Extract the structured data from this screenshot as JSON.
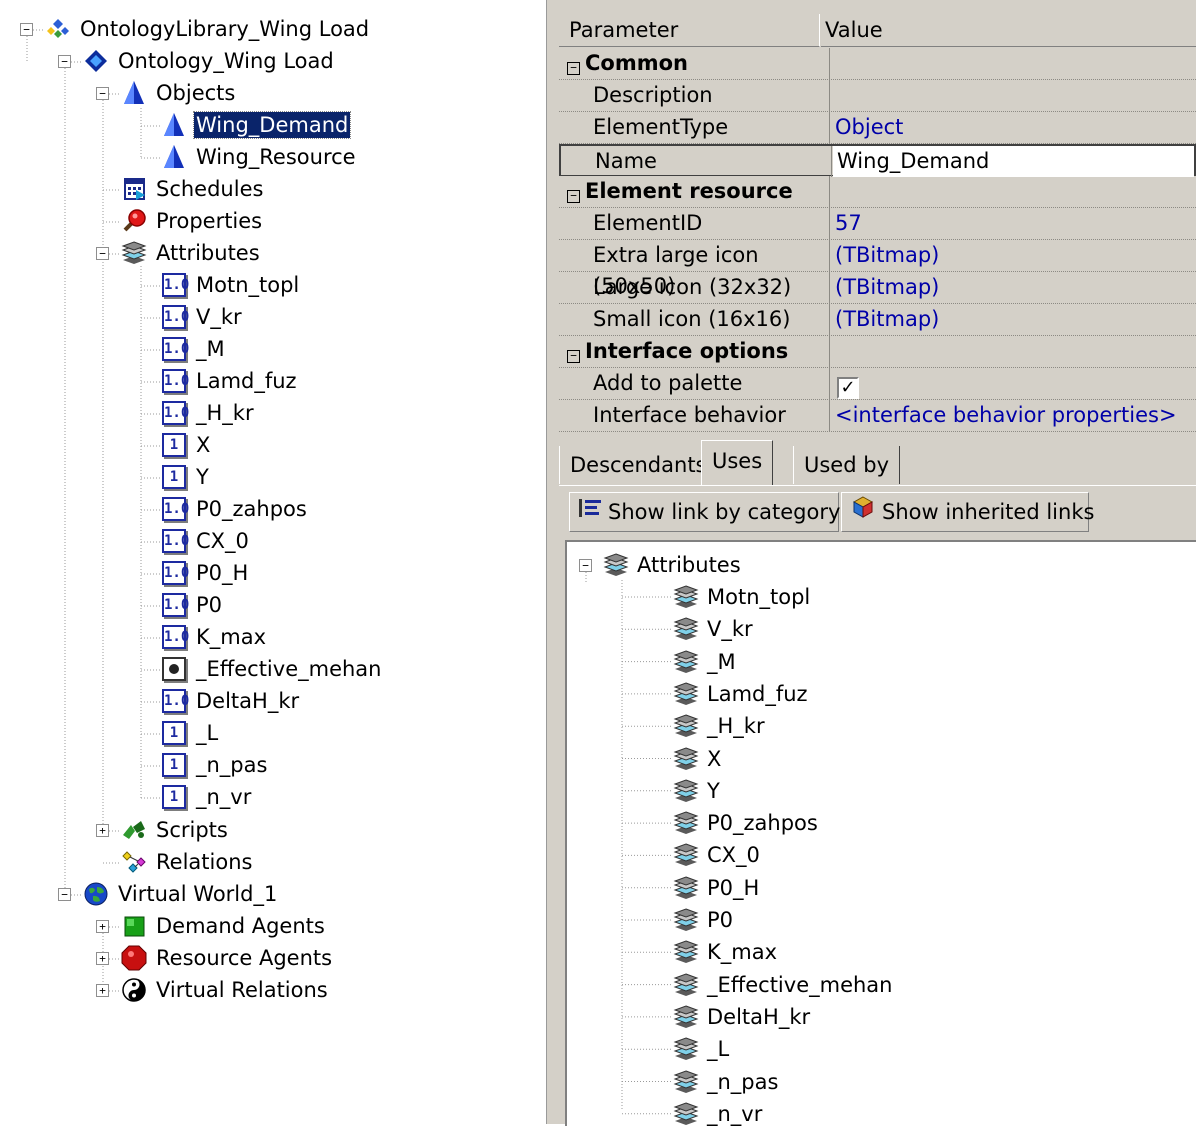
{
  "left_tree": {
    "root": {
      "label": "OntologyLibrary_Wing Load",
      "icon": "ontology-library-icon"
    },
    "ontology": {
      "label": "Ontology_Wing Load",
      "icon": "ontology-diamond-icon"
    },
    "objects": {
      "label": "Objects",
      "icon": "object-cone-icon"
    },
    "wing_demand": {
      "label": "Wing_Demand",
      "icon": "object-cone-icon"
    },
    "wing_resource": {
      "label": "Wing_Resource",
      "icon": "object-cone-icon"
    },
    "schedules": {
      "label": "Schedules",
      "icon": "calendar-icon"
    },
    "properties": {
      "label": "Properties",
      "icon": "magnifier-icon"
    },
    "attributes": {
      "label": "Attributes",
      "icon": "layers-icon"
    },
    "attribute_items": [
      {
        "label": "Motn_topl",
        "badge": "1.0"
      },
      {
        "label": "V_kr",
        "badge": "1.0"
      },
      {
        "label": "_M",
        "badge": "1.0"
      },
      {
        "label": "Lamd_fuz",
        "badge": "1.0"
      },
      {
        "label": "_H_kr",
        "badge": "1.0"
      },
      {
        "label": "X",
        "badge": "1"
      },
      {
        "label": "Y",
        "badge": "1"
      },
      {
        "label": "P0_zahpos",
        "badge": "1.0"
      },
      {
        "label": "CX_0",
        "badge": "1.0"
      },
      {
        "label": "P0_H",
        "badge": "1.0"
      },
      {
        "label": "P0",
        "badge": "1.0"
      },
      {
        "label": "K_max",
        "badge": "1.0"
      },
      {
        "label": "_Effective_mehan",
        "badge": ""
      },
      {
        "label": "DeltaH_kr",
        "badge": "1.0"
      },
      {
        "label": "_L",
        "badge": "1"
      },
      {
        "label": "_n_pas",
        "badge": "1"
      },
      {
        "label": "_n_vr",
        "badge": "1"
      }
    ],
    "scripts": {
      "label": "Scripts",
      "icon": "scripts-icon"
    },
    "relations": {
      "label": "Relations",
      "icon": "relations-icon"
    },
    "virtual_world": {
      "label": "Virtual World_1",
      "icon": "globe-icon"
    },
    "demand_agents": {
      "label": "Demand Agents",
      "icon": "green-square-icon"
    },
    "resource_agents": {
      "label": "Resource Agents",
      "icon": "red-octagon-icon"
    },
    "virtual_relations": {
      "label": "Virtual Relations",
      "icon": "yin-yang-icon"
    }
  },
  "inspector": {
    "col_parameter": "Parameter",
    "col_value": "Value",
    "rows": [
      {
        "param": "Common",
        "value": "",
        "category": true
      },
      {
        "param": "Description",
        "value": ""
      },
      {
        "param": "ElementType",
        "value": "Object"
      },
      {
        "param": "Name",
        "value": "Wing_Demand",
        "editing": true
      },
      {
        "param": "Element resource",
        "value": "",
        "category": true
      },
      {
        "param": "ElementID",
        "value": "57"
      },
      {
        "param": "Extra large icon (50x50)",
        "value": "(TBitmap)"
      },
      {
        "param": "Large icon (32x32)",
        "value": "(TBitmap)"
      },
      {
        "param": "Small icon (16x16)",
        "value": "(TBitmap)"
      },
      {
        "param": "Interface options",
        "value": "",
        "category": true
      },
      {
        "param": "Add to palette",
        "value": "",
        "checkbox": true,
        "checked": true
      },
      {
        "param": "Interface behavior",
        "value": "<interface behavior properties>"
      }
    ]
  },
  "tabs": {
    "descendants": "Descendants",
    "uses": "Uses",
    "used_by": "Used by",
    "active": "Uses"
  },
  "toolbar": {
    "show_link_by_category": "Show link by category",
    "show_inherited_links": "Show inherited links"
  },
  "uses_tree": {
    "root": "Attributes",
    "items": [
      "Motn_topl",
      "V_kr",
      "_M",
      "Lamd_fuz",
      "_H_kr",
      "X",
      "Y",
      "P0_zahpos",
      "CX_0",
      "P0_H",
      "P0",
      "K_max",
      "_Effective_mehan",
      "DeltaH_kr",
      "_L",
      "_n_pas",
      "_n_vr"
    ]
  },
  "colors": {
    "selection": "#0a246a",
    "link_value": "#0000a8",
    "panel": "#d4d0c8",
    "badge": "#1d2aa0"
  }
}
